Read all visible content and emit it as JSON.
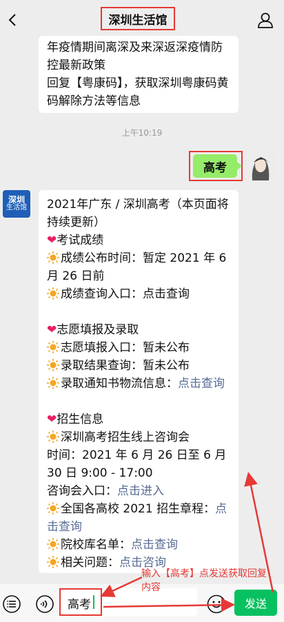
{
  "header": {
    "title": "深圳生活馆"
  },
  "messages": {
    "incoming_1": {
      "lines": [
        "年疫情期间离深及来深返深疫情防",
        "控最新政策",
        "回复【粤康码】，获取深圳粤康码黄",
        "码解除方法等信息"
      ]
    },
    "timestamp": "上午10:19",
    "outgoing": {
      "text": "高考"
    },
    "bot_avatar": {
      "line1": "深圳",
      "line2": "生活馆"
    },
    "incoming_2": {
      "title": "2021年广东 / 深圳高考（本页面将持续更新）",
      "sec1_title": "考试成绩",
      "sec1_item1": "成绩公布时间：暂定 2021 年 6 月 26 日前",
      "sec1_item2": "成绩查询入口：点击查询",
      "sec2_title": "志愿填报及录取",
      "sec2_item1": "志愿填报入口：暂未公布",
      "sec2_item2": "录取结果查询：暂未公布",
      "sec2_item3_label": "录取通知书物流信息：",
      "sec2_item3_link": "点击查询",
      "sec3_title": "招生信息",
      "sec3_item1": "深圳高考招生线上咨询会",
      "sec3_time": "时间：2021 年 6 月 26 日至 6 月 30 日  9:00 - 17:00",
      "sec3_entry_label": "咨询会入口：",
      "sec3_entry_link": "点击进入",
      "sec3_item2_label": "全国各高校 2021 招生章程：",
      "sec3_item2_link": "点击查询",
      "sec3_item3_label": "院校库名单：",
      "sec3_item3_link": "点击查询",
      "sec3_item4_label": "相关问题：",
      "sec3_item4_link": "点击咨询"
    }
  },
  "annotation": {
    "text": "输入【高考】点发送获取回复内容"
  },
  "input_bar": {
    "value": "高考",
    "send_label": "发送"
  },
  "colors": {
    "accent": "#07c160",
    "bubble_out": "#95ec69",
    "highlight": "#e53935",
    "link": "#576b95"
  }
}
